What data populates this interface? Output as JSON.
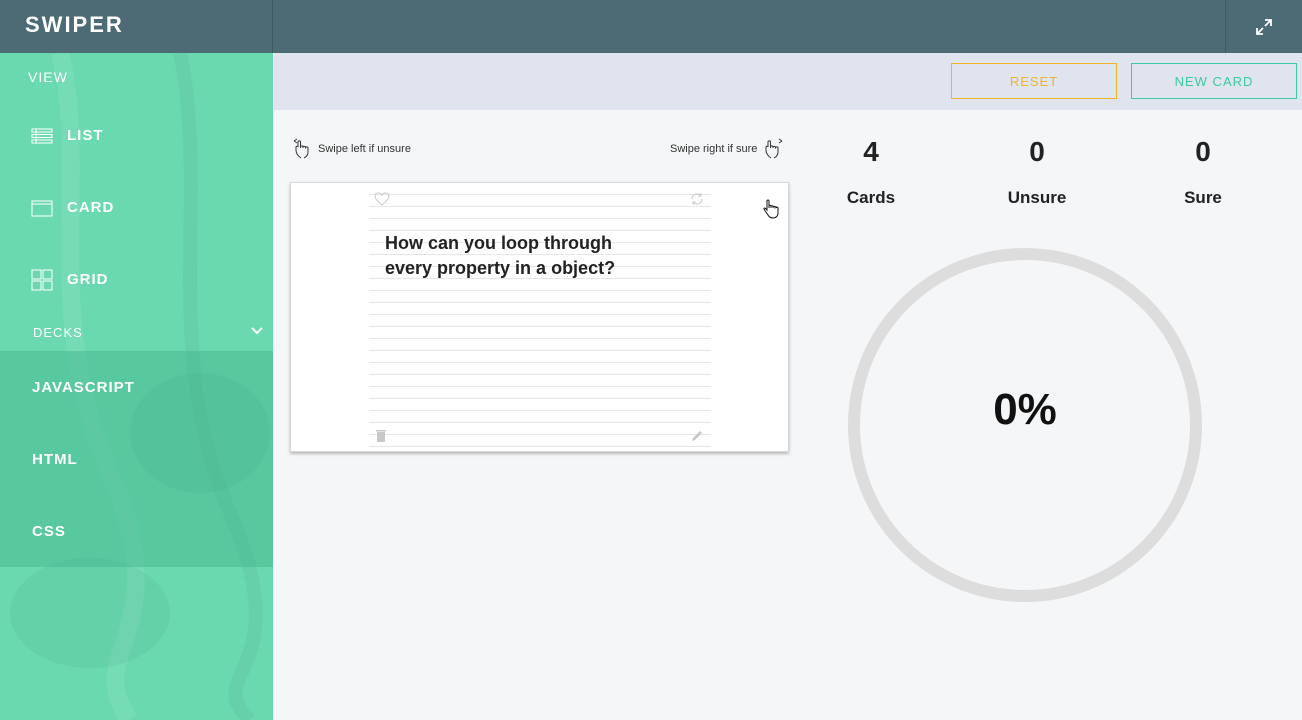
{
  "app": {
    "title": "SWIPER"
  },
  "sidebar": {
    "view_label": "VIEW",
    "view_items": [
      {
        "label": "LIST",
        "icon": "list-icon"
      },
      {
        "label": "CARD",
        "icon": "card-icon"
      },
      {
        "label": "GRID",
        "icon": "grid-icon"
      }
    ],
    "decks_label": "DECKS",
    "decks": [
      {
        "label": "JAVASCRIPT"
      },
      {
        "label": "HTML"
      },
      {
        "label": "CSS"
      }
    ]
  },
  "toolbar": {
    "reset_label": "RESET",
    "new_card_label": "NEW CARD"
  },
  "hints": {
    "left": "Swipe left if unsure",
    "right": "Swipe right if sure"
  },
  "card": {
    "question": "How can you loop through every property in a object?"
  },
  "stats": {
    "cards": {
      "value": "4",
      "label": "Cards"
    },
    "unsure": {
      "value": "0",
      "label": "Unsure"
    },
    "sure": {
      "value": "0",
      "label": "Sure"
    }
  },
  "progress": {
    "value": 0,
    "label": "0%"
  },
  "colors": {
    "topbar": "#4d6b75",
    "sidebar": "#6ad9b0",
    "reset": "#f0b429",
    "new_card": "#3ec9a0",
    "ring": "#dddddd"
  }
}
